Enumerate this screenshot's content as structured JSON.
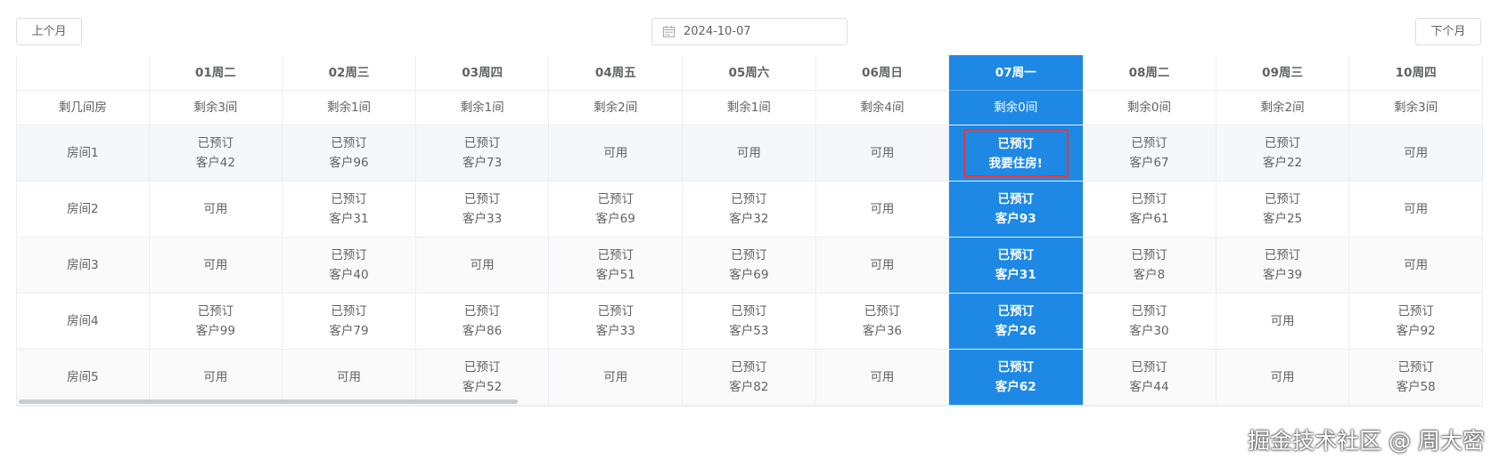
{
  "toolbar": {
    "prev_label": "上个月",
    "next_label": "下个月",
    "date_value": "2024-10-07"
  },
  "table": {
    "corner_label": "",
    "remain_label": "剩几间房",
    "days": [
      {
        "label": "01周二",
        "remain": "剩余3间"
      },
      {
        "label": "02周三",
        "remain": "剩余1间"
      },
      {
        "label": "03周四",
        "remain": "剩余1间"
      },
      {
        "label": "04周五",
        "remain": "剩余2间"
      },
      {
        "label": "05周六",
        "remain": "剩余1间"
      },
      {
        "label": "06周日",
        "remain": "剩余4间"
      },
      {
        "label": "07周一",
        "remain": "剩余0间",
        "today": true
      },
      {
        "label": "08周二",
        "remain": "剩余0间"
      },
      {
        "label": "09周三",
        "remain": "剩余2间"
      },
      {
        "label": "10周四",
        "remain": "剩余3间"
      }
    ],
    "rooms": [
      {
        "name": "房间1",
        "cells": [
          [
            "已预订",
            "客户42"
          ],
          [
            "已预订",
            "客户96"
          ],
          [
            "已预订",
            "客户73"
          ],
          [
            "可用"
          ],
          [
            "可用"
          ],
          [
            "可用"
          ],
          [
            "已预订",
            "我要住房!"
          ],
          [
            "已预订",
            "客户67"
          ],
          [
            "已预订",
            "客户22"
          ],
          [
            "可用"
          ]
        ]
      },
      {
        "name": "房间2",
        "cells": [
          [
            "可用"
          ],
          [
            "已预订",
            "客户31"
          ],
          [
            "已预订",
            "客户33"
          ],
          [
            "已预订",
            "客户69"
          ],
          [
            "已预订",
            "客户32"
          ],
          [
            "可用"
          ],
          [
            "已预订",
            "客户93"
          ],
          [
            "已预订",
            "客户61"
          ],
          [
            "已预订",
            "客户25"
          ],
          [
            "可用"
          ]
        ]
      },
      {
        "name": "房间3",
        "cells": [
          [
            "可用"
          ],
          [
            "已预订",
            "客户40"
          ],
          [
            "可用"
          ],
          [
            "已预订",
            "客户51"
          ],
          [
            "已预订",
            "客户69"
          ],
          [
            "可用"
          ],
          [
            "已预订",
            "客户31"
          ],
          [
            "已预订",
            "客户8"
          ],
          [
            "已预订",
            "客户39"
          ],
          [
            "可用"
          ]
        ]
      },
      {
        "name": "房间4",
        "cells": [
          [
            "已预订",
            "客户99"
          ],
          [
            "已预订",
            "客户79"
          ],
          [
            "已预订",
            "客户86"
          ],
          [
            "已预订",
            "客户33"
          ],
          [
            "已预订",
            "客户53"
          ],
          [
            "已预订",
            "客户36"
          ],
          [
            "已预订",
            "客户26"
          ],
          [
            "已预订",
            "客户30"
          ],
          [
            "可用"
          ],
          [
            "已预订",
            "客户92"
          ]
        ]
      },
      {
        "name": "房间5",
        "cells": [
          [
            "可用"
          ],
          [
            "可用"
          ],
          [
            "已预订",
            "客户52"
          ],
          [
            "可用"
          ],
          [
            "已预订",
            "客户82"
          ],
          [
            "可用"
          ],
          [
            "已预订",
            "客户62"
          ],
          [
            "已预订",
            "客户44"
          ],
          [
            "可用"
          ],
          [
            "已预订",
            "客户58"
          ]
        ]
      }
    ],
    "selected": {
      "room": 0,
      "day": 6
    }
  },
  "watermark": "掘金技术社区 @ 周大密",
  "colors": {
    "today_bg": "#1e88e5",
    "selected_border": "#e53935",
    "border": "#ebeef5"
  }
}
